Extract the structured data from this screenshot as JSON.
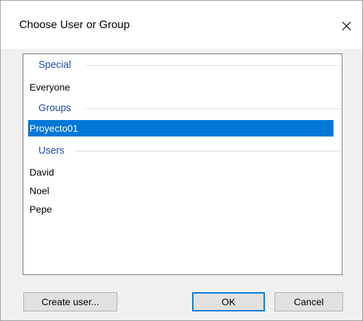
{
  "window": {
    "title": "Choose User or Group"
  },
  "list": {
    "groups": [
      {
        "header": "Special",
        "items": [
          {
            "label": "Everyone",
            "selected": false
          }
        ]
      },
      {
        "header": "Groups",
        "items": [
          {
            "label": "Proyecto01",
            "selected": true
          }
        ]
      },
      {
        "header": "Users",
        "items": [
          {
            "label": "David",
            "selected": false
          },
          {
            "label": "Noel",
            "selected": false
          },
          {
            "label": "Pepe",
            "selected": false
          }
        ]
      }
    ]
  },
  "buttons": {
    "create_user": "Create user...",
    "ok": "OK",
    "cancel": "Cancel"
  },
  "colors": {
    "selection": "#0078d7",
    "group_header": "#1f49a8"
  },
  "icons": {
    "close": "close-icon"
  }
}
